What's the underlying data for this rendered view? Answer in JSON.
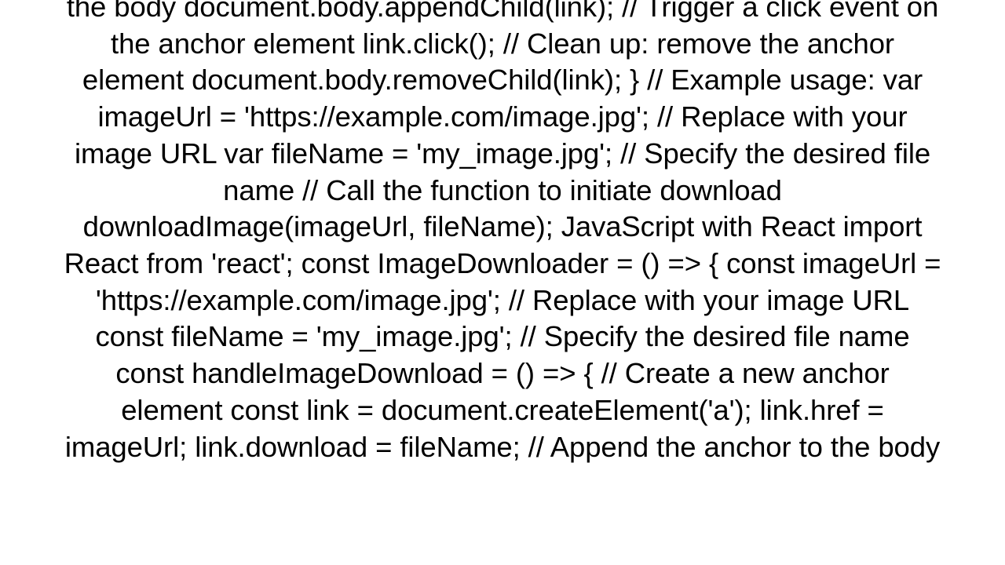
{
  "body_text": "the body document.body.appendChild(link);  // Trigger a click event on the anchor element link.click();  // Clean up: remove the anchor element document.body.removeChild(link); }  // Example usage: var imageUrl = 'https://example.com/image.jpg'; // Replace with your image URL var fileName = 'my_image.jpg'; // Specify the desired file name  // Call the function to initiate download downloadImage(imageUrl, fileName);  JavaScript with React import React from 'react';  const ImageDownloader = () => {   const imageUrl = 'https://example.com/image.jpg'; // Replace with your image URL   const fileName = 'my_image.jpg'; // Specify the desired file name    const handleImageDownload = () => {     // Create a new anchor element     const link = document.createElement('a');     link.href = imageUrl;     link.download = fileName;  // Append the anchor to the body"
}
